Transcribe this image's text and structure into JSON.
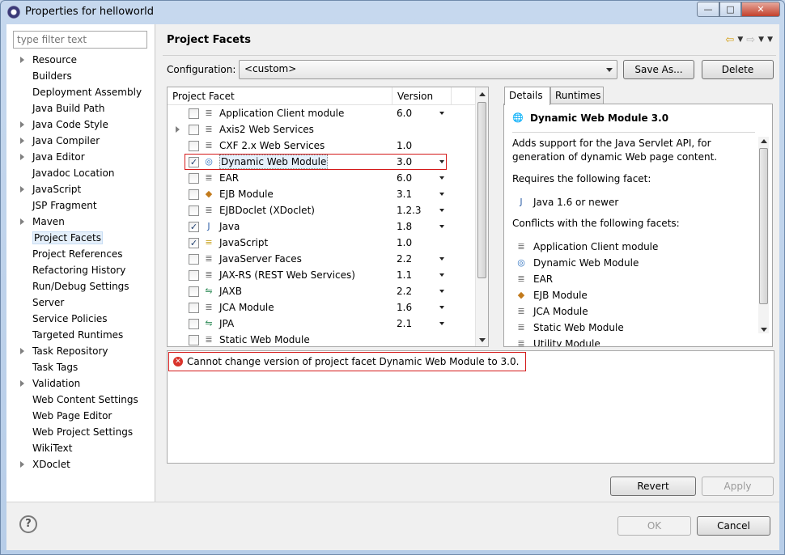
{
  "window": {
    "title": "Properties for helloworld"
  },
  "left_panel": {
    "filter_placeholder": "type filter text",
    "items": [
      {
        "label": "Resource",
        "expandable": true
      },
      {
        "label": "Builders",
        "expandable": false
      },
      {
        "label": "Deployment Assembly",
        "expandable": false
      },
      {
        "label": "Java Build Path",
        "expandable": false
      },
      {
        "label": "Java Code Style",
        "expandable": true
      },
      {
        "label": "Java Compiler",
        "expandable": true
      },
      {
        "label": "Java Editor",
        "expandable": true
      },
      {
        "label": "Javadoc Location",
        "expandable": false
      },
      {
        "label": "JavaScript",
        "expandable": true
      },
      {
        "label": "JSP Fragment",
        "expandable": false
      },
      {
        "label": "Maven",
        "expandable": true
      },
      {
        "label": "Project Facets",
        "expandable": false,
        "selected": true
      },
      {
        "label": "Project References",
        "expandable": false
      },
      {
        "label": "Refactoring History",
        "expandable": false
      },
      {
        "label": "Run/Debug Settings",
        "expandable": false
      },
      {
        "label": "Server",
        "expandable": false
      },
      {
        "label": "Service Policies",
        "expandable": false
      },
      {
        "label": "Targeted Runtimes",
        "expandable": false
      },
      {
        "label": "Task Repository",
        "expandable": true
      },
      {
        "label": "Task Tags",
        "expandable": false
      },
      {
        "label": "Validation",
        "expandable": true
      },
      {
        "label": "Web Content Settings",
        "expandable": false
      },
      {
        "label": "Web Page Editor",
        "expandable": false
      },
      {
        "label": "Web Project Settings",
        "expandable": false
      },
      {
        "label": "WikiText",
        "expandable": false
      },
      {
        "label": "XDoclet",
        "expandable": true
      }
    ]
  },
  "page": {
    "title": "Project Facets",
    "configuration_label": "Configuration:",
    "configuration_value": "<custom>",
    "save_as_label": "Save As...",
    "delete_label": "Delete"
  },
  "facet_table": {
    "col_facet": "Project Facet",
    "col_version": "Version",
    "rows": [
      {
        "name": "Application Client module",
        "version": "6.0",
        "checked": false,
        "dropdown": true,
        "expandable": false,
        "icon": "page-icon"
      },
      {
        "name": "Axis2 Web Services",
        "version": "",
        "checked": false,
        "dropdown": false,
        "expandable": true,
        "icon": "page-icon"
      },
      {
        "name": "CXF 2.x Web Services",
        "version": "1.0",
        "checked": false,
        "dropdown": false,
        "expandable": false,
        "icon": "page-icon"
      },
      {
        "name": "Dynamic Web Module",
        "version": "3.0",
        "checked": true,
        "dropdown": true,
        "expandable": false,
        "icon": "globe-icon",
        "highlight": true
      },
      {
        "name": "EAR",
        "version": "6.0",
        "checked": false,
        "dropdown": true,
        "expandable": false,
        "icon": "page-icon"
      },
      {
        "name": "EJB Module",
        "version": "3.1",
        "checked": false,
        "dropdown": true,
        "expandable": false,
        "icon": "bean-icon"
      },
      {
        "name": "EJBDoclet (XDoclet)",
        "version": "1.2.3",
        "checked": false,
        "dropdown": true,
        "expandable": false,
        "icon": "page-icon"
      },
      {
        "name": "Java",
        "version": "1.8",
        "checked": true,
        "dropdown": true,
        "expandable": false,
        "icon": "java-icon"
      },
      {
        "name": "JavaScript",
        "version": "1.0",
        "checked": true,
        "dropdown": false,
        "expandable": false,
        "icon": "js-icon"
      },
      {
        "name": "JavaServer Faces",
        "version": "2.2",
        "checked": false,
        "dropdown": true,
        "expandable": false,
        "icon": "page-icon"
      },
      {
        "name": "JAX-RS (REST Web Services)",
        "version": "1.1",
        "checked": false,
        "dropdown": true,
        "expandable": false,
        "icon": "page-icon"
      },
      {
        "name": "JAXB",
        "version": "2.2",
        "checked": false,
        "dropdown": true,
        "expandable": false,
        "icon": "jaxb-icon"
      },
      {
        "name": "JCA Module",
        "version": "1.6",
        "checked": false,
        "dropdown": true,
        "expandable": false,
        "icon": "page-icon"
      },
      {
        "name": "JPA",
        "version": "2.1",
        "checked": false,
        "dropdown": true,
        "expandable": false,
        "icon": "jaxb-icon"
      },
      {
        "name": "Static Web Module",
        "version": "",
        "checked": false,
        "dropdown": false,
        "expandable": false,
        "icon": "page-icon"
      }
    ]
  },
  "details": {
    "tab_details": "Details",
    "tab_runtimes": "Runtimes",
    "title": "Dynamic Web Module 3.0",
    "description": "Adds support for the Java Servlet API, for generation of dynamic Web page content.",
    "requires_label": "Requires the following facet:",
    "requires": [
      {
        "label": "Java 1.6 or newer",
        "icon": "java-icon"
      }
    ],
    "conflicts_label": "Conflicts with the following facets:",
    "conflicts": [
      {
        "label": "Application Client module",
        "icon": "page-icon"
      },
      {
        "label": "Dynamic Web Module",
        "icon": "globe-icon"
      },
      {
        "label": "EAR",
        "icon": "page-icon"
      },
      {
        "label": "EJB Module",
        "icon": "bean-icon"
      },
      {
        "label": "JCA Module",
        "icon": "page-icon"
      },
      {
        "label": "Static Web Module",
        "icon": "page-icon"
      },
      {
        "label": "Utility Module",
        "icon": "page-icon"
      }
    ]
  },
  "message": {
    "text": "Cannot change version of project facet Dynamic Web Module to 3.0."
  },
  "buttons": {
    "revert": "Revert",
    "apply": "Apply",
    "ok": "OK",
    "cancel": "Cancel"
  }
}
